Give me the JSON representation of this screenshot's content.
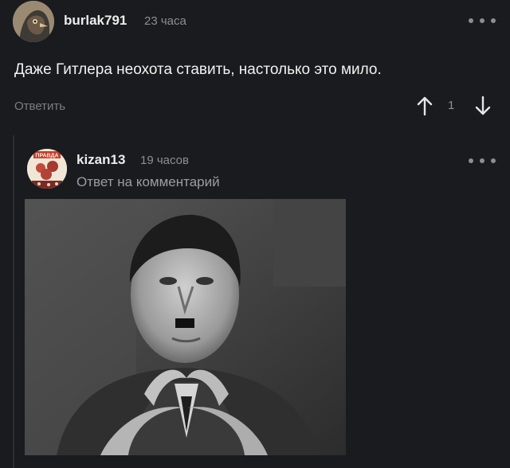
{
  "comment": {
    "author": "burlak791",
    "time": "23 часа",
    "text": "Даже Гитлера неохота ставить, настолько это мило.",
    "reply_label": "Ответить",
    "score": "1"
  },
  "reply": {
    "author": "kizan13",
    "time": "19 часов",
    "reply_to_label": "Ответ на комментарий",
    "avatar_caption": "ПРАВДА"
  },
  "icons": {
    "more": "more-horizontal-icon",
    "upvote": "arrow-up-icon",
    "downvote": "arrow-down-icon"
  }
}
